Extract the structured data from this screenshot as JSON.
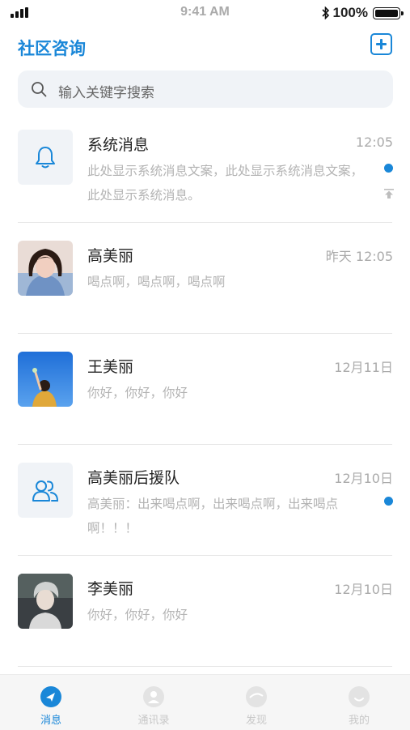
{
  "status_bar": {
    "time": "9:41 AM",
    "battery": "100%"
  },
  "header": {
    "title": "社区咨询"
  },
  "search": {
    "placeholder": "输入关键字搜索"
  },
  "conversations": [
    {
      "name": "系统消息",
      "time": "12:05",
      "preview": "此处显示系统消息文案，此处显示系统消息文案，此处显示系统消息。",
      "unread": true,
      "pinned": true,
      "avatar": "bell-icon"
    },
    {
      "name": "高美丽",
      "time": "昨天 12:05",
      "preview": "喝点啊，喝点啊，喝点啊",
      "unread": false,
      "avatar": "photo-woman"
    },
    {
      "name": "王美丽",
      "time": "12月11日",
      "preview": "你好，你好，你好",
      "unread": false,
      "avatar": "photo-blue-sky"
    },
    {
      "name": "高美丽后援队",
      "time": "12月10日",
      "preview": "高美丽：出来喝点啊，出来喝点啊，出来喝点啊！！！",
      "unread": true,
      "avatar": "group-icon"
    },
    {
      "name": "李美丽",
      "time": "12月10日",
      "preview": "你好，你好，你好",
      "unread": false,
      "avatar": "photo-person"
    }
  ],
  "tabbar": {
    "items": [
      {
        "label": "消息",
        "active": true,
        "icon": "send-icon"
      },
      {
        "label": "通讯录",
        "active": false,
        "icon": "contacts-icon"
      },
      {
        "label": "发现",
        "active": false,
        "icon": "discover-icon"
      },
      {
        "label": "我的",
        "active": false,
        "icon": "profile-icon"
      }
    ]
  },
  "colors": {
    "accent": "#1a87d8",
    "muted": "#b3b3b3",
    "search_bg": "#f0f3f7"
  }
}
